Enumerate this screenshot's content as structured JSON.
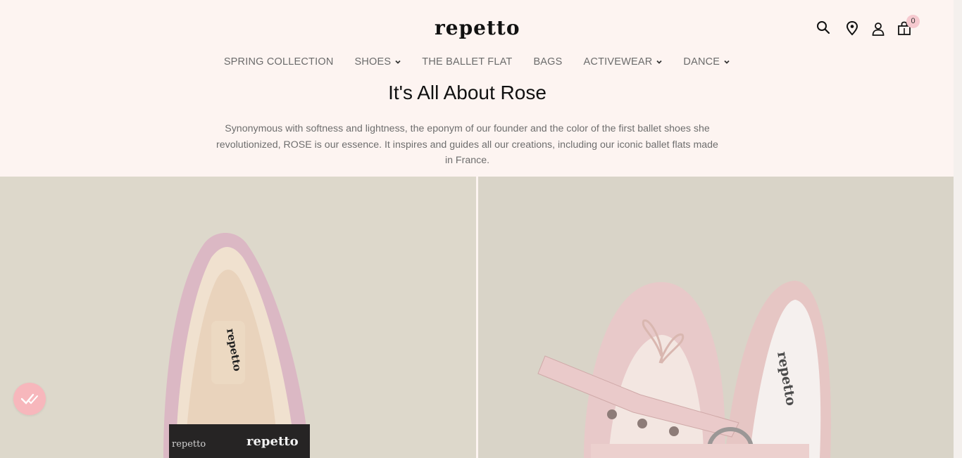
{
  "brand": {
    "logo_text": "Repetto"
  },
  "header_icons": [
    "search-icon",
    "location-icon",
    "account-icon",
    "cart-icon"
  ],
  "cart": {
    "count": "0"
  },
  "nav": {
    "items": [
      {
        "label": "SPRING COLLECTION",
        "has_dropdown": false
      },
      {
        "label": "SHOES",
        "has_dropdown": true
      },
      {
        "label": "THE BALLET FLAT",
        "has_dropdown": false
      },
      {
        "label": "BAGS",
        "has_dropdown": false
      },
      {
        "label": "ACTIVEWEAR",
        "has_dropdown": true
      },
      {
        "label": "DANCE",
        "has_dropdown": true
      }
    ]
  },
  "hero": {
    "title": "It's All About Rose",
    "text": "Synonymous with softness and lightness, the eponym of our founder and the color of the first ballet shoes she revolutionized, ROSE is our essence. It inspires and guides all our creations, including our iconic ballet flats made in France."
  },
  "colors": {
    "page_bg": "#fdf4f1",
    "badge_pink": "#f7b7bc",
    "shoe_pink": "#e8c9c9",
    "photo_bg": "#ddd8cb"
  }
}
